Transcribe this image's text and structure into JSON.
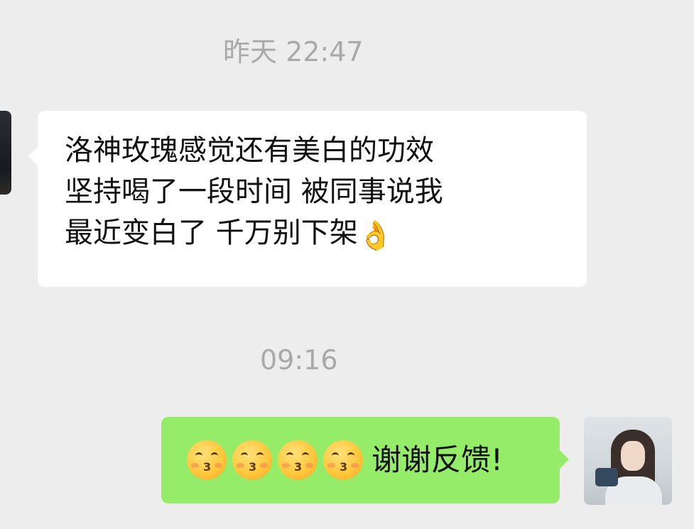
{
  "timestamps": {
    "first": "昨天 22:47",
    "second": "09:16"
  },
  "incoming_message": {
    "lines": [
      "洛神玫瑰感觉还有美白的功效",
      "坚持喝了一段时间 被同事说我",
      "最近变白了 千万别下架"
    ],
    "emoji": "👌"
  },
  "outgoing_message": {
    "emoji_count": 4,
    "emoji_name": "kissing-face-smiling-eyes",
    "text": "谢谢反馈!"
  },
  "colors": {
    "background": "#ededed",
    "incoming_bubble": "#ffffff",
    "outgoing_bubble": "#95ec69",
    "timestamp": "#a9a9a9"
  }
}
